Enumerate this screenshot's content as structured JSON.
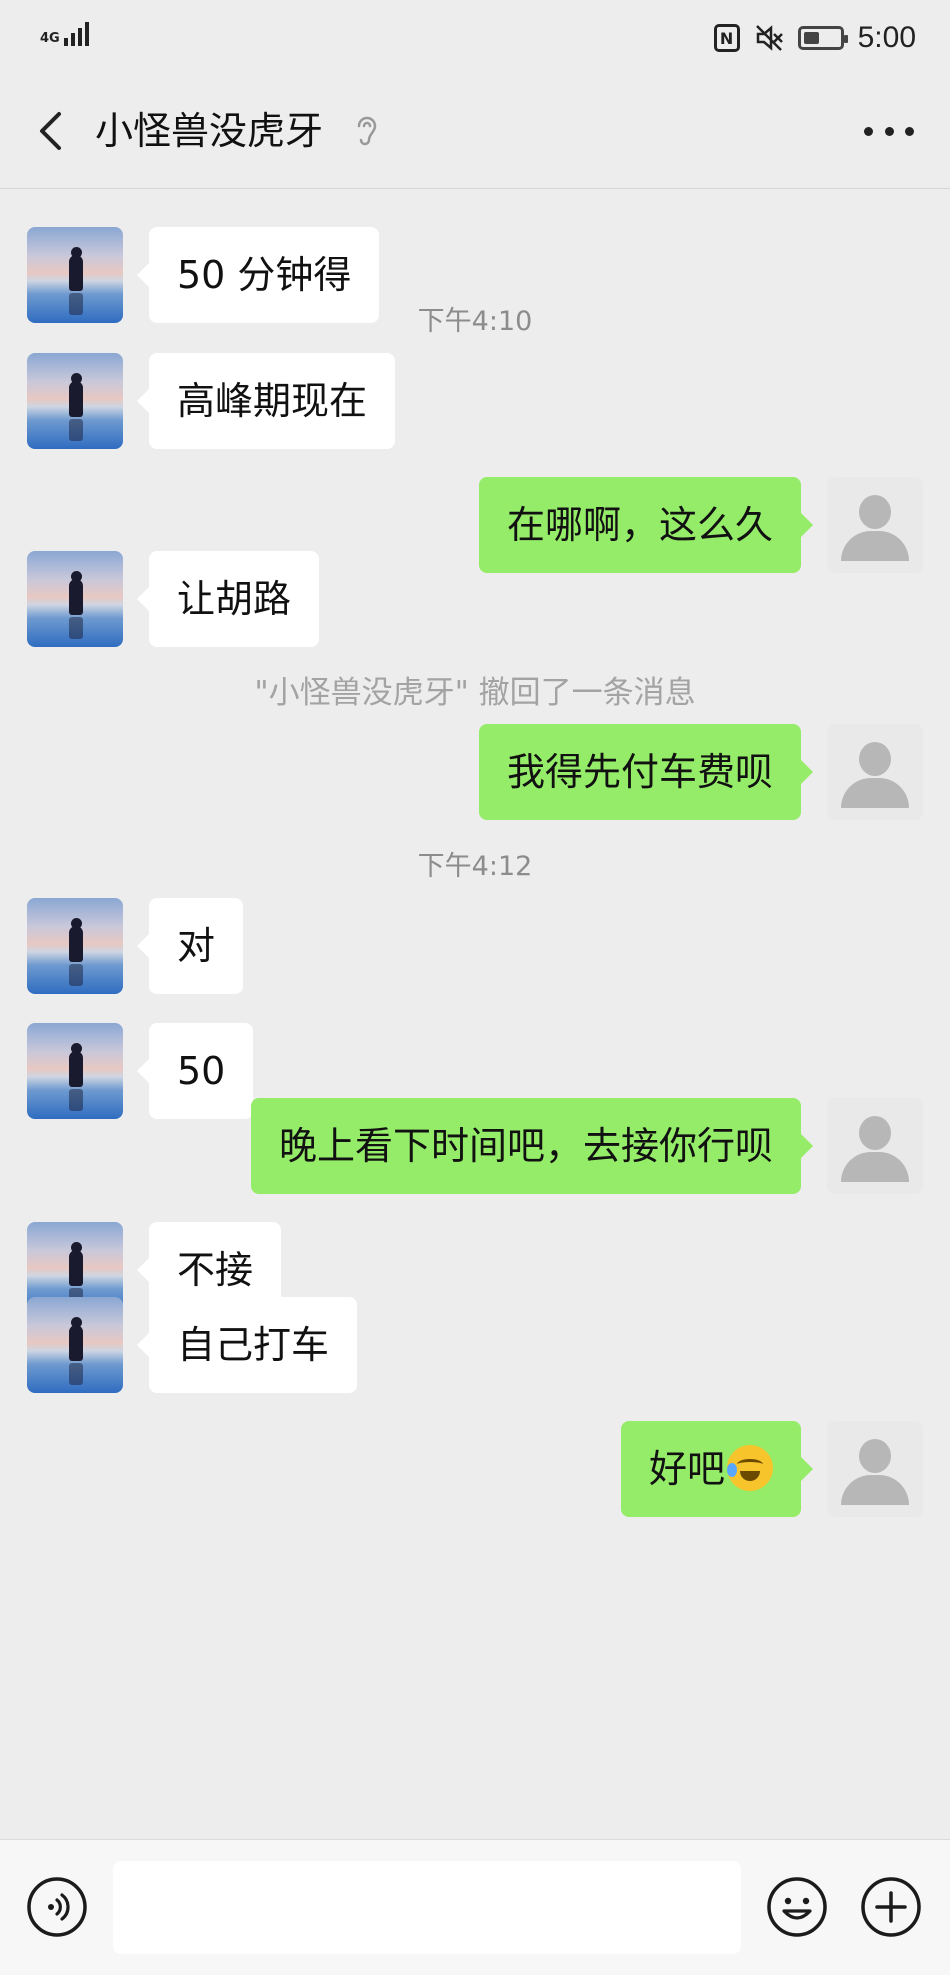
{
  "status_bar": {
    "network": "4G",
    "time": "5:00",
    "nfc_label": "N",
    "battery_level": 0.45
  },
  "header": {
    "title": "小怪兽没虎牙"
  },
  "messages": [
    {
      "side": "in",
      "text": "50 分钟得"
    },
    {
      "time": "下午4:10"
    },
    {
      "side": "in",
      "text": "高峰期现在"
    },
    {
      "side": "out",
      "text": "在哪啊，这么久"
    },
    {
      "side": "in",
      "text": "让胡路"
    },
    {
      "notice": "\"小怪兽没虎牙\" 撤回了一条消息"
    },
    {
      "side": "out",
      "text": "我得先付车费呗"
    },
    {
      "time": "下午4:12"
    },
    {
      "side": "in",
      "text": "对"
    },
    {
      "side": "in",
      "text": "50"
    },
    {
      "side": "out",
      "text": "晚上看下时间吧，去接你行呗"
    },
    {
      "side": "in",
      "text": "不接"
    },
    {
      "side": "in",
      "text": "自己打车"
    },
    {
      "side": "out",
      "text": "好吧",
      "emoji": "face-with-tears-of-joy"
    }
  ],
  "input_bar": {
    "placeholder": "",
    "value": ""
  },
  "colors": {
    "sent_bubble": "#95ec69",
    "received_bubble": "#ffffff",
    "background": "#ededed"
  }
}
